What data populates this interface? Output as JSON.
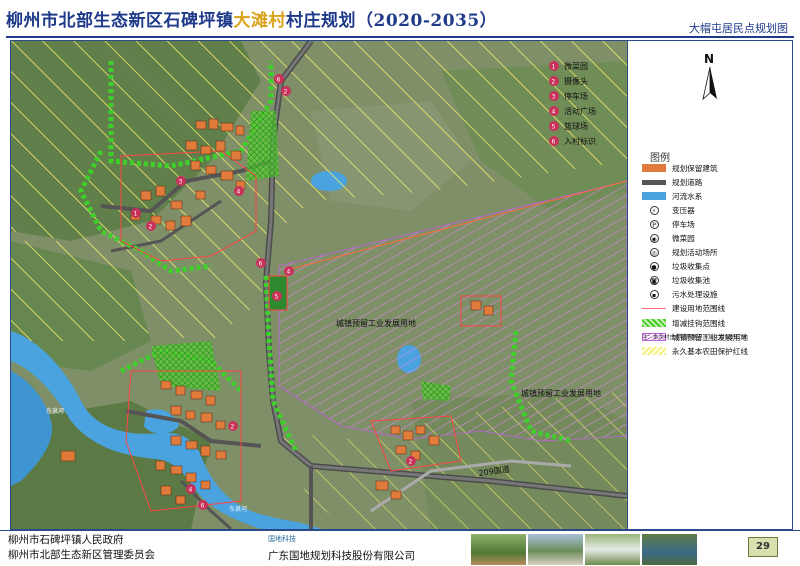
{
  "header": {
    "title_pre": "柳州市北部生态新区石碑坪镇",
    "title_village": "大滩村",
    "title_post": "村庄规划（2020-2035）",
    "subtitle": "大帽屯居民点规划图"
  },
  "map": {
    "key_items": [
      {
        "num": "1",
        "label": "微菜园"
      },
      {
        "num": "2",
        "label": "摄像头"
      },
      {
        "num": "3",
        "label": "停车场"
      },
      {
        "num": "4",
        "label": "活动广场"
      },
      {
        "num": "5",
        "label": "篮球场"
      },
      {
        "num": "6",
        "label": "入村标识"
      }
    ],
    "zone_label_1": "城镇预留工业发展用地",
    "zone_label_2": "城镇预留工业发展用地",
    "road_label": "209国道",
    "river_label_1": "东泉河",
    "river_label_2": "东泉河",
    "colors": {
      "building": "#e07b3c",
      "road": "#555555",
      "water": "#4aa3df",
      "village_boundary": "#ff5a5a",
      "green": "#44cc22",
      "industrial_hatch": "#d888e8",
      "farmland_hatch": "#f2ec6a",
      "marker": "#c8325a"
    }
  },
  "legend": {
    "compass_letter": "N",
    "title": "图例",
    "items": [
      {
        "label": "规划保留建筑",
        "icon": "building-swatch"
      },
      {
        "label": "规划道路",
        "icon": "road-swatch"
      },
      {
        "label": "河流水系",
        "icon": "water-swatch"
      },
      {
        "label": "变压器",
        "icon": "transformer-icon",
        "glyph": "⚡"
      },
      {
        "label": "停车场",
        "icon": "parking-icon",
        "glyph": "P"
      },
      {
        "label": "微菜园",
        "icon": "garden-icon",
        "glyph": "◉"
      },
      {
        "label": "规划活动场所",
        "icon": "activity-icon",
        "glyph": "◎"
      },
      {
        "label": "垃圾收集点",
        "icon": "trash-point-icon",
        "glyph": "●"
      },
      {
        "label": "垃圾收集池",
        "icon": "trash-pool-icon",
        "glyph": "◙"
      },
      {
        "label": "污水处理设施",
        "icon": "sewage-icon",
        "glyph": "▪"
      },
      {
        "label": "建设用地范围线",
        "icon": "construction-line-swatch"
      },
      {
        "label": "增减挂钩范围线",
        "icon": "green-hatch-swatch"
      },
      {
        "label": "城镇预留工业发展用地",
        "icon": "industrial-hatch-swatch"
      },
      {
        "label": "永久基本农田保护红线",
        "icon": "farmland-hatch-swatch"
      }
    ],
    "note": "注：本次村庄规划范围不涉及生态保护红线"
  },
  "footer": {
    "org_1": "柳州市石碑坪镇人民政府",
    "org_2": "柳州市北部生态新区管理委员会",
    "org_3": "广东国地规划科技股份有限公司",
    "logo_text": "国地科技",
    "page_number": "29"
  }
}
